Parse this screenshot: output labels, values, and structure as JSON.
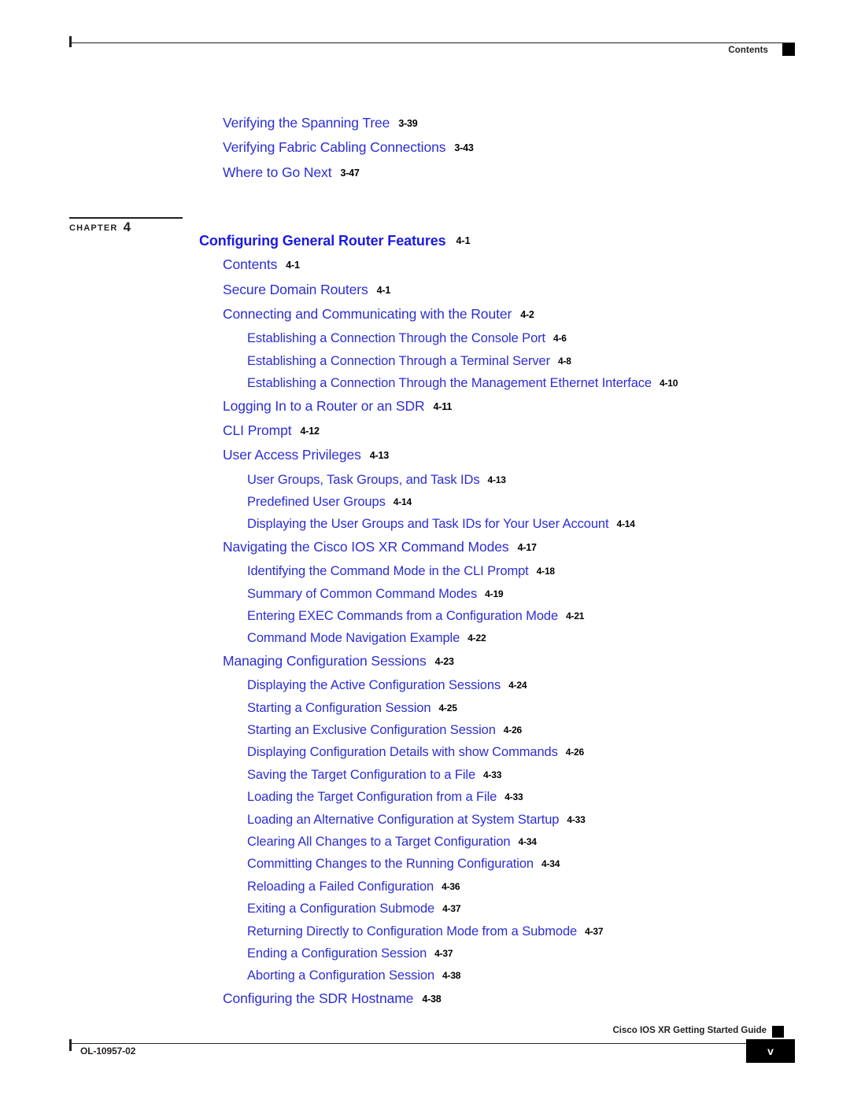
{
  "header": {
    "label": "Contents"
  },
  "chapter": {
    "word": "CHAPTER",
    "number": "4",
    "title": "Configuring General Router Features",
    "page": "4-1"
  },
  "toc": {
    "before_chapter": [
      {
        "level": 1,
        "title": "Verifying the Spanning Tree",
        "page": "3-39"
      },
      {
        "level": 1,
        "title": "Verifying Fabric Cabling Connections",
        "page": "3-43"
      },
      {
        "level": 1,
        "title": "Where to Go Next",
        "page": "3-47"
      }
    ],
    "after_chapter": [
      {
        "level": 1,
        "title": "Contents",
        "page": "4-1"
      },
      {
        "level": 1,
        "title": "Secure Domain Routers",
        "page": "4-1"
      },
      {
        "level": 1,
        "title": "Connecting and Communicating with the Router",
        "page": "4-2"
      },
      {
        "level": 2,
        "title": "Establishing a Connection Through the Console Port",
        "page": "4-6"
      },
      {
        "level": 2,
        "title": "Establishing a Connection Through a Terminal Server",
        "page": "4-8"
      },
      {
        "level": 2,
        "title": "Establishing a Connection Through the Management Ethernet Interface",
        "page": "4-10"
      },
      {
        "level": 1,
        "title": "Logging In to a Router or an SDR",
        "page": "4-11"
      },
      {
        "level": 1,
        "title": "CLI Prompt",
        "page": "4-12"
      },
      {
        "level": 1,
        "title": "User Access Privileges",
        "page": "4-13"
      },
      {
        "level": 2,
        "title": "User Groups, Task Groups, and Task IDs",
        "page": "4-13"
      },
      {
        "level": 2,
        "title": "Predefined User Groups",
        "page": "4-14"
      },
      {
        "level": 2,
        "title": "Displaying the User Groups and Task IDs for Your User Account",
        "page": "4-14"
      },
      {
        "level": 1,
        "title": "Navigating the Cisco IOS XR Command Modes",
        "page": "4-17"
      },
      {
        "level": 2,
        "title": "Identifying the Command Mode in the CLI Prompt",
        "page": "4-18"
      },
      {
        "level": 2,
        "title": "Summary of Common Command Modes",
        "page": "4-19"
      },
      {
        "level": 2,
        "title": "Entering EXEC Commands from a Configuration Mode",
        "page": "4-21"
      },
      {
        "level": 2,
        "title": "Command Mode Navigation Example",
        "page": "4-22"
      },
      {
        "level": 1,
        "title": "Managing Configuration Sessions",
        "page": "4-23"
      },
      {
        "level": 2,
        "title": "Displaying the Active Configuration Sessions",
        "page": "4-24"
      },
      {
        "level": 2,
        "title": "Starting a Configuration Session",
        "page": "4-25"
      },
      {
        "level": 2,
        "title": "Starting an Exclusive Configuration Session",
        "page": "4-26"
      },
      {
        "level": 2,
        "title": "Displaying Configuration Details with show Commands",
        "page": "4-26"
      },
      {
        "level": 2,
        "title": "Saving the Target Configuration to a File",
        "page": "4-33"
      },
      {
        "level": 2,
        "title": "Loading the Target Configuration from a File",
        "page": "4-33"
      },
      {
        "level": 2,
        "title": "Loading an Alternative Configuration at System Startup",
        "page": "4-33"
      },
      {
        "level": 2,
        "title": "Clearing All Changes to a Target Configuration",
        "page": "4-34"
      },
      {
        "level": 2,
        "title": "Committing Changes to the Running Configuration",
        "page": "4-34"
      },
      {
        "level": 2,
        "title": "Reloading a Failed Configuration",
        "page": "4-36"
      },
      {
        "level": 2,
        "title": "Exiting a Configuration Submode",
        "page": "4-37"
      },
      {
        "level": 2,
        "title": "Returning Directly to Configuration Mode from a Submode",
        "page": "4-37"
      },
      {
        "level": 2,
        "title": "Ending a Configuration Session",
        "page": "4-37"
      },
      {
        "level": 2,
        "title": "Aborting a Configuration Session",
        "page": "4-38"
      },
      {
        "level": 1,
        "title": "Configuring the SDR Hostname",
        "page": "4-38"
      }
    ]
  },
  "footer": {
    "guide_title": "Cisco IOS XR Getting Started Guide",
    "doc_id": "OL-10957-02",
    "page_number": "v"
  },
  "colors": {
    "entry_blue": "#2d2dd4",
    "chapter_blue": "#1a1ae2",
    "ink": "#231f20"
  }
}
